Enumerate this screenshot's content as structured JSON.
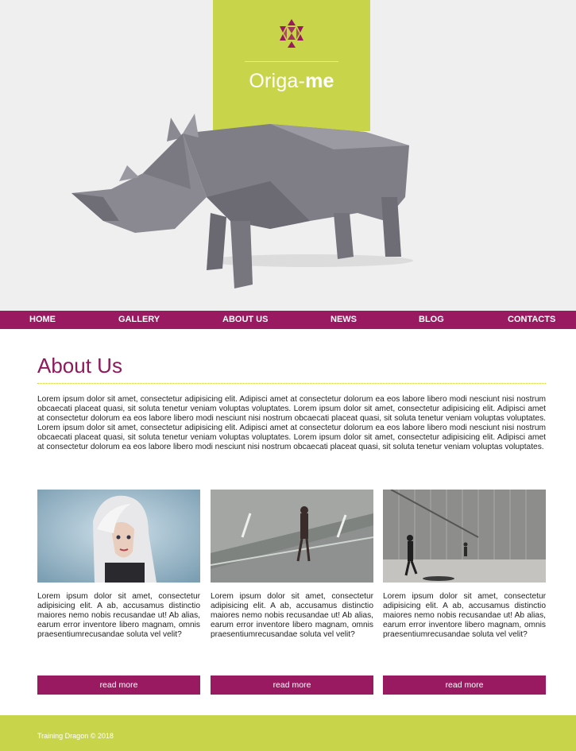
{
  "brand": {
    "name_light": "Origa-",
    "name_bold": "me",
    "logo_color": "#9a1a62",
    "accent": "#c8d54b"
  },
  "nav": {
    "items": [
      {
        "label": "HOME"
      },
      {
        "label": "GALLERY"
      },
      {
        "label": "ABOUT US"
      },
      {
        "label": "NEWS"
      },
      {
        "label": "BLOG"
      },
      {
        "label": "CONTACTS"
      }
    ],
    "color": "#9a1a62"
  },
  "main": {
    "title": "About Us",
    "intro": "Lorem ipsum dolor sit amet, consectetur adipisicing elit. Adipisci amet at consectetur dolorum ea eos labore libero modi nesciunt nisi nostrum obcaecati placeat quasi, sit soluta tenetur veniam voluptas voluptates. Lorem ipsum dolor sit amet, consectetur adipisicing elit. Adipisci amet at consectetur dolorum ea eos labore libero modi nesciunt nisi nostrum obcaecati placeat quasi, sit soluta tenetur veniam voluptas voluptates. Lorem ipsum dolor sit amet, consectetur adipisicing elit. Adipisci amet at consectetur dolorum ea eos labore libero modi nesciunt nisi nostrum obcaecati placeat quasi, sit soluta tenetur veniam voluptas voluptates. Lorem ipsum dolor sit amet, consectetur adipisicing elit. Adipisci amet at consectetur dolorum ea eos labore libero modi nesciunt nisi nostrum obcaecati placeat quasi, sit soluta tenetur veniam voluptas voluptates.",
    "cards": [
      {
        "image": "woman-portrait-photo",
        "text": "Lorem ipsum dolor sit amet, consectetur adipisicing elit. A ab, accusamus distinctio maiores nemo nobis recusandae ut! Ab alias, earum error inventore libero magnam, omnis praesentiumrecusandae soluta vel velit?",
        "button": "read more"
      },
      {
        "image": "man-walking-road-photo",
        "text": "Lorem ipsum dolor sit amet, consectetur adipisicing elit. A ab, accusamus distinctio maiores nemo nobis recusandae ut! Ab alias, earum error inventore libero magnam, omnis praesentiumrecusandae soluta vel velit?",
        "button": "read more"
      },
      {
        "image": "people-walking-building-photo",
        "text": "Lorem ipsum dolor sit amet, consectetur adipisicing elit. A ab, accusamus distinctio maiores nemo nobis recusandae ut! Ab alias, earum error inventore libero magnam, omnis praesentiumrecusandae soluta vel velit?",
        "button": "read more"
      }
    ]
  },
  "footer": {
    "text": "Training Dragon © 2018"
  }
}
